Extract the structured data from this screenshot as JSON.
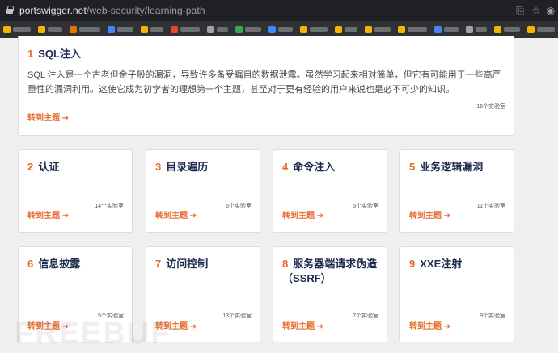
{
  "browser": {
    "url_host": "portswigger.net",
    "url_path": "/web-security/learning-path"
  },
  "bookmarks": {
    "colors": [
      "#f4b400",
      "#f4b400",
      "#e37400",
      "#4285f4",
      "#f4b400",
      "#ea4335",
      "#a0a0a0",
      "#34a853",
      "#4285f4",
      "#f4b400",
      "#f4b400",
      "#f4b400",
      "#f4b400",
      "#4285f4",
      "#a0a0a0",
      "#f4b400",
      "#f4b400",
      "#f4b400",
      "#ea4335",
      "#f4b400"
    ]
  },
  "topics": [
    {
      "num": "1",
      "name": "SQL注入",
      "desc": "SQL 注入是一个古老但金子般的漏洞，导致许多备受瞩目的数据泄露。虽然学习起来相对简单，但它有可能用于一些高严重性的漏洞利用。这使它成为初学者的理想第一个主题，甚至对于更有经验的用户来说也是必不可少的知识。",
      "labs": "16个实验室",
      "go": "转到主题 ➔"
    },
    {
      "num": "2",
      "name": "认证",
      "labs": "14个实验室",
      "go": "转到主题 ➔"
    },
    {
      "num": "3",
      "name": "目录遍历",
      "labs": "6个实验室",
      "go": "转到主题 ➔"
    },
    {
      "num": "4",
      "name": "命令注入",
      "labs": "5个实验室",
      "go": "转到主题 ➔"
    },
    {
      "num": "5",
      "name": "业务逻辑漏洞",
      "labs": "11个实验室",
      "go": "转到主题 ➔"
    },
    {
      "num": "6",
      "name": "信息披露",
      "labs": "5个实验室",
      "go": "转到主题 ➔"
    },
    {
      "num": "7",
      "name": "访问控制",
      "labs": "13个实验室",
      "go": "转到主题 ➔"
    },
    {
      "num": "8",
      "name": "服务器端请求伪造（SSRF）",
      "labs": "7个实验室",
      "go": "转到主题 ➔"
    },
    {
      "num": "9",
      "name": "XXE注射",
      "labs": "9个实验室",
      "go": "转到主题 ➔"
    }
  ],
  "watermark": "FREEBUF"
}
